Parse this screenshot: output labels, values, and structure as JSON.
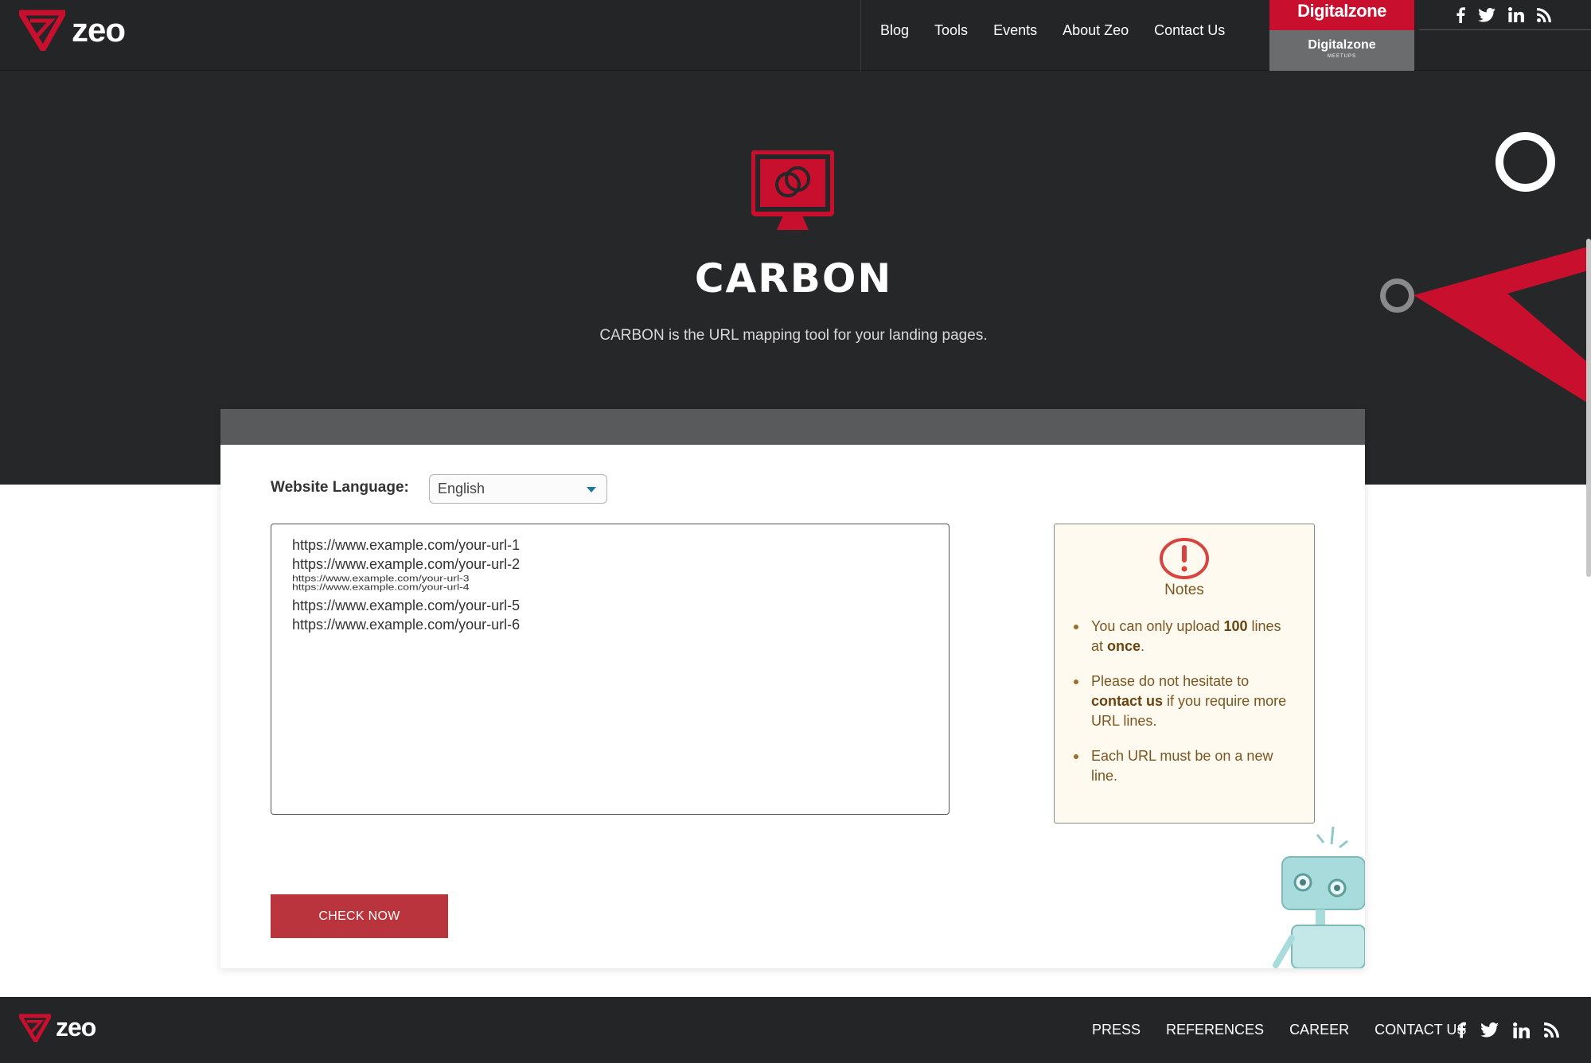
{
  "header": {
    "logo_text": "zeo",
    "nav": [
      "Blog",
      "Tools",
      "Events",
      "About Zeo",
      "Contact Us"
    ],
    "digitalzone": "Digitalzone",
    "digitalzone_meetups": "Digitalzone",
    "digitalzone_meetups_small": "MEETUPS",
    "social": [
      "facebook-icon",
      "twitter-icon",
      "linkedin-icon",
      "rss-icon"
    ]
  },
  "hero": {
    "title": "CARBON",
    "subtitle": "CARBON is the URL mapping tool for your landing pages."
  },
  "form": {
    "language_label": "Website Language:",
    "language_value": "English",
    "urls": [
      "https://www.example.com/your-url-1",
      "https://www.example.com/your-url-2",
      "https://www.example.com/your-url-3",
      "https://www.example.com/your-url-4",
      "https://www.example.com/your-url-5",
      "https://www.example.com/your-url-6"
    ],
    "check_label": "CHECK NOW"
  },
  "notes": {
    "title": "Notes",
    "item1_a": "You can only upload ",
    "item1_b": "100",
    "item1_c": " lines at ",
    "item1_d": "once",
    "item1_e": ".",
    "item2_a": "Please do not hesitate to ",
    "item2_b": "contact us",
    "item2_c": " if you require more URL lines.",
    "item3": "Each URL must be on a new line."
  },
  "footer": {
    "logo_text": "zeo",
    "nav": [
      "PRESS",
      "REFERENCES",
      "CAREER",
      "CONTACT US"
    ]
  },
  "colors": {
    "brand_red": "#c8102e",
    "button_red": "#b9343c",
    "dark_bg": "#262728"
  }
}
